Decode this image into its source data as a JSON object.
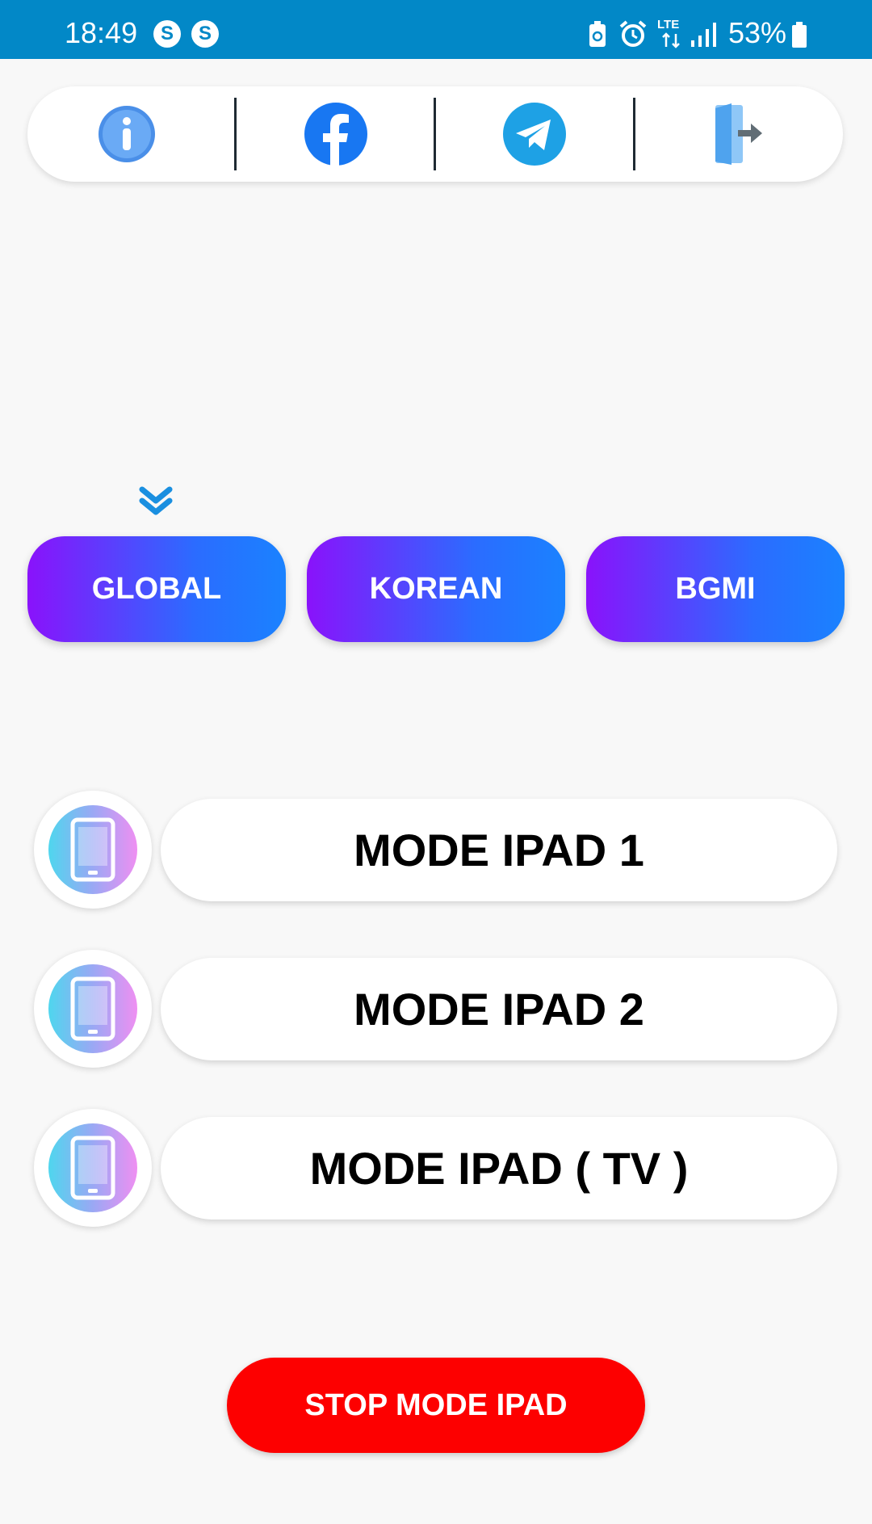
{
  "status_bar": {
    "time": "18:49",
    "app_icon_1": "S",
    "app_icon_2": "S",
    "network": "LTE",
    "battery": "53%",
    "icons": [
      "s-app-icon",
      "s-app-icon",
      "battery-saver-icon",
      "alarm-icon",
      "lte-icon",
      "signal-icon",
      "battery-icon"
    ]
  },
  "top_bar": {
    "items": [
      {
        "name": "info",
        "icon": "info-icon"
      },
      {
        "name": "facebook",
        "icon": "facebook-icon"
      },
      {
        "name": "telegram",
        "icon": "telegram-icon"
      },
      {
        "name": "exit",
        "icon": "exit-door-icon"
      }
    ]
  },
  "regions": {
    "selected": "GLOBAL",
    "buttons": [
      "GLOBAL",
      "KOREAN",
      "BGMI"
    ]
  },
  "modes": [
    {
      "label": "MODE IPAD 1",
      "icon": "tablet-icon"
    },
    {
      "label": "MODE IPAD 2",
      "icon": "tablet-icon"
    },
    {
      "label": "MODE IPAD ( TV )",
      "icon": "tablet-icon"
    }
  ],
  "stop_button": "STOP MODE IPAD",
  "colors": {
    "status_bar": "#0288c7",
    "region_gradient_start": "#8a12fb",
    "region_gradient_end": "#1a82ff",
    "stop_button": "#fd0000",
    "background": "#f8f8f8"
  }
}
